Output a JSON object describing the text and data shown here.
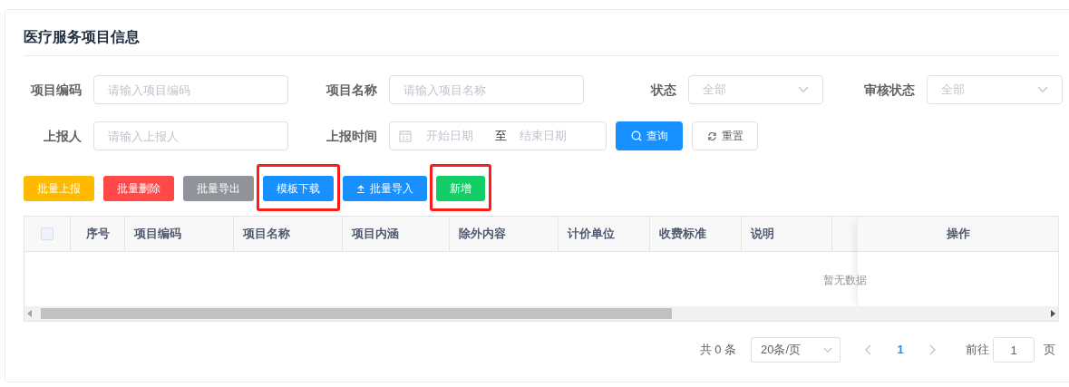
{
  "title": "医疗服务项目信息",
  "filters_row_1": [
    {
      "kind": "input",
      "label": "项目编码",
      "placeholder": "请输入项目编码"
    },
    {
      "kind": "input",
      "label": "项目名称",
      "placeholder": "请输入项目名称"
    },
    {
      "kind": "select",
      "label": "状态",
      "placeholder": "全部"
    },
    {
      "kind": "select",
      "label": "审核状态",
      "placeholder": "全部"
    }
  ],
  "filters_row_2": [
    {
      "kind": "input",
      "label": "上报人",
      "placeholder": "请输入上报人"
    },
    {
      "kind": "daterange",
      "label": "上报时间",
      "start_placeholder": "开始日期",
      "separator": "至",
      "end_placeholder": "结束日期"
    }
  ],
  "search_button": "查询",
  "reset_button": "重置",
  "actions": [
    {
      "kind": "plain",
      "label": "批量上报",
      "color": "#ffba00",
      "highlighted": false
    },
    {
      "kind": "plain",
      "label": "批量删除",
      "color": "#ff4949",
      "highlighted": false
    },
    {
      "kind": "plain",
      "label": "批量导出",
      "color": "#909399",
      "highlighted": false
    },
    {
      "kind": "plain",
      "label": "模板下载",
      "color": "#1890ff",
      "highlighted": true
    },
    {
      "kind": "upload",
      "label": "批量导入",
      "color": "#1890ff",
      "highlighted": false
    },
    {
      "kind": "plain",
      "label": "新增",
      "color": "#13ce66",
      "highlighted": true
    }
  ],
  "table": {
    "select_all_checked": false,
    "columns": [
      "序号",
      "项目编码",
      "项目名称",
      "项目内涵",
      "除外内容",
      "计价单位",
      "收费标准",
      "说明"
    ],
    "fixed_column": "操作",
    "empty_text": "暂无数据"
  },
  "pagination": {
    "total": "共 0 条",
    "page_size": "20条/页",
    "pages": [
      {
        "label": "1",
        "selected": true
      }
    ],
    "goto_label": "前往",
    "goto_value": "1",
    "goto_suffix": "页"
  }
}
